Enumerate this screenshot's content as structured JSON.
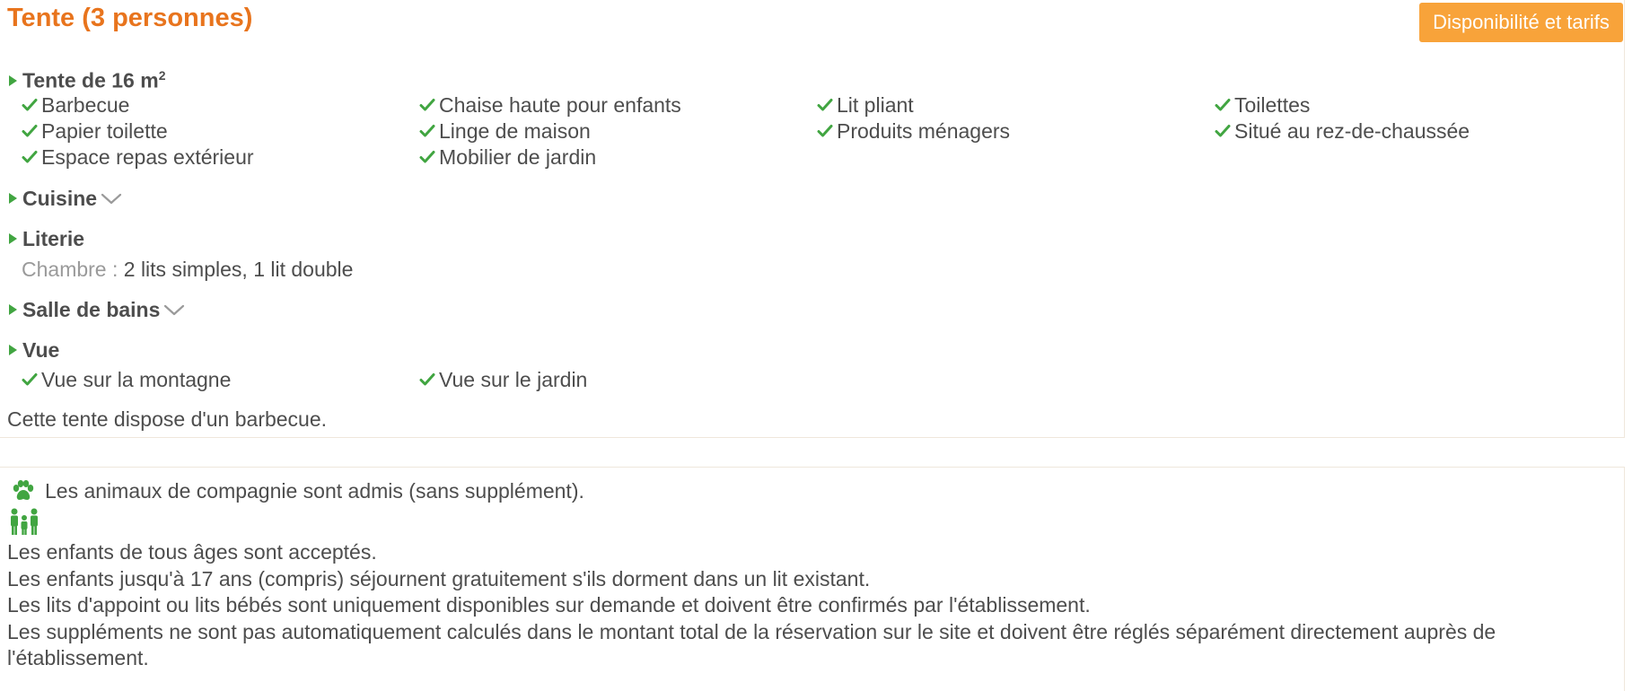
{
  "room": {
    "title": "Tente (3 personnes)",
    "cta_label": "Disponibilité et tarifs",
    "cta_color": "#f8a33a",
    "title_color": "#e8741d",
    "check_color": "#41a541",
    "sections": {
      "size": {
        "label": "Tente de 16 m",
        "sup": "2",
        "items": [
          "Barbecue",
          "Chaise haute pour enfants",
          "Lit pliant",
          "Toilettes",
          "Papier toilette",
          "Linge de maison",
          "Produits ménagers",
          "Situé au rez-de-chaussée",
          "Espace repas extérieur",
          "Mobilier de jardin"
        ]
      },
      "kitchen": {
        "label": "Cuisine"
      },
      "bedding": {
        "label": "Literie",
        "room_label": "Chambre :",
        "room_value": "2 lits simples, 1 lit double"
      },
      "bathroom": {
        "label": "Salle de bains"
      },
      "view": {
        "label": "Vue",
        "items": [
          "Vue sur la montagne",
          "Vue sur le jardin"
        ]
      }
    },
    "description": "Cette tente dispose d'un barbecue."
  },
  "policies": {
    "pets": "Les animaux de compagnie sont admis (sans supplément).",
    "children": [
      "Les enfants de tous âges sont acceptés.",
      "Les enfants jusqu'à 17 ans (compris) séjournent gratuitement s'ils dorment dans un lit existant.",
      "Les lits d'appoint ou lits bébés sont uniquement disponibles sur demande et doivent être confirmés par l'établissement.",
      "Les suppléments ne sont pas automatiquement calculés dans le montant total de la réservation sur le site et doivent être réglés séparément directement auprès de l'établissement."
    ]
  }
}
